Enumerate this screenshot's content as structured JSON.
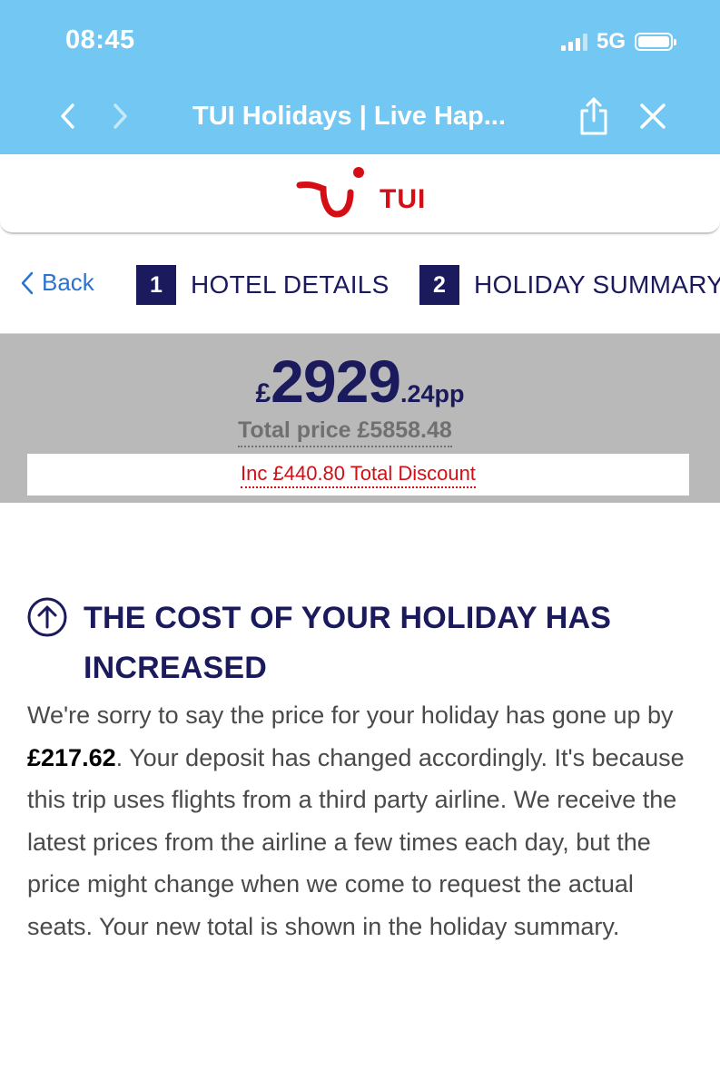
{
  "status_bar": {
    "time": "08:45",
    "network": "5G"
  },
  "browser": {
    "title": "TUI Holidays | Live Hap...",
    "back_icon": "chevron-left-icon",
    "forward_icon": "chevron-right-icon",
    "share_icon": "share-icon",
    "close_icon": "close-icon"
  },
  "header": {
    "logo_text": "TUI",
    "brand_color": "#d40e14"
  },
  "steps": {
    "back_label": "Back",
    "items": [
      {
        "number": "1",
        "label": "HOTEL DETAILS"
      },
      {
        "number": "2",
        "label": "HOLIDAY SUMMARY"
      }
    ]
  },
  "price": {
    "currency": "£",
    "whole": "2929",
    "decimal_suffix": ".24pp",
    "total": "Total price £5858.48",
    "discount": "Inc £440.80 Total Discount"
  },
  "notice": {
    "icon": "arrow-up-circle-icon",
    "title": "THE COST OF YOUR HOLIDAY HAS INCREASED",
    "body_prefix": "We're sorry to say the price for your holiday has gone up by ",
    "increase_amount": "£217.62",
    "body_suffix": ". Your deposit has changed accordingly. It's because this trip uses flights from a third party airline. We receive the latest prices from the airline a few times each day, but the price might change when we come to request the actual seats. Your new total is shown in the holiday summary."
  },
  "colors": {
    "chrome_bg": "#72c8f2",
    "navy": "#1b1a5c",
    "panel_grey": "#b9b9b9",
    "link_blue": "#2a73cf"
  }
}
